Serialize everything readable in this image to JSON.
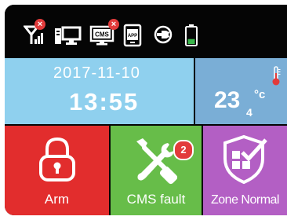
{
  "status_bar": {
    "icons": [
      {
        "name": "signal-icon",
        "badge": "x"
      },
      {
        "name": "network-icon"
      },
      {
        "name": "cms-monitor-icon",
        "label": "CMS",
        "badge": "x"
      },
      {
        "name": "app-phone-icon",
        "label": "APP"
      },
      {
        "name": "power-plug-icon"
      },
      {
        "name": "battery-icon",
        "level": 0.3,
        "color": "#39b54a"
      }
    ]
  },
  "clock": {
    "date": "2017-11-10",
    "time": "13:55"
  },
  "temperature": {
    "value": "23",
    "decimal": "4",
    "unit": "°c"
  },
  "tiles": {
    "arm": {
      "label": "Arm",
      "icon": "padlock-icon",
      "color": "#e22d2d"
    },
    "cms_fault": {
      "label": "CMS fault",
      "icon": "tools-icon",
      "badge": "2",
      "color": "#67bd49"
    },
    "zone": {
      "label": "Zone Normal",
      "icon": "shield-check-icon",
      "color": "#b35fc4"
    }
  },
  "colors": {
    "background": "#050505",
    "date_tile": "#8fd0ee",
    "temp_tile": "#7aaed6",
    "badge": "#e23b3b"
  }
}
